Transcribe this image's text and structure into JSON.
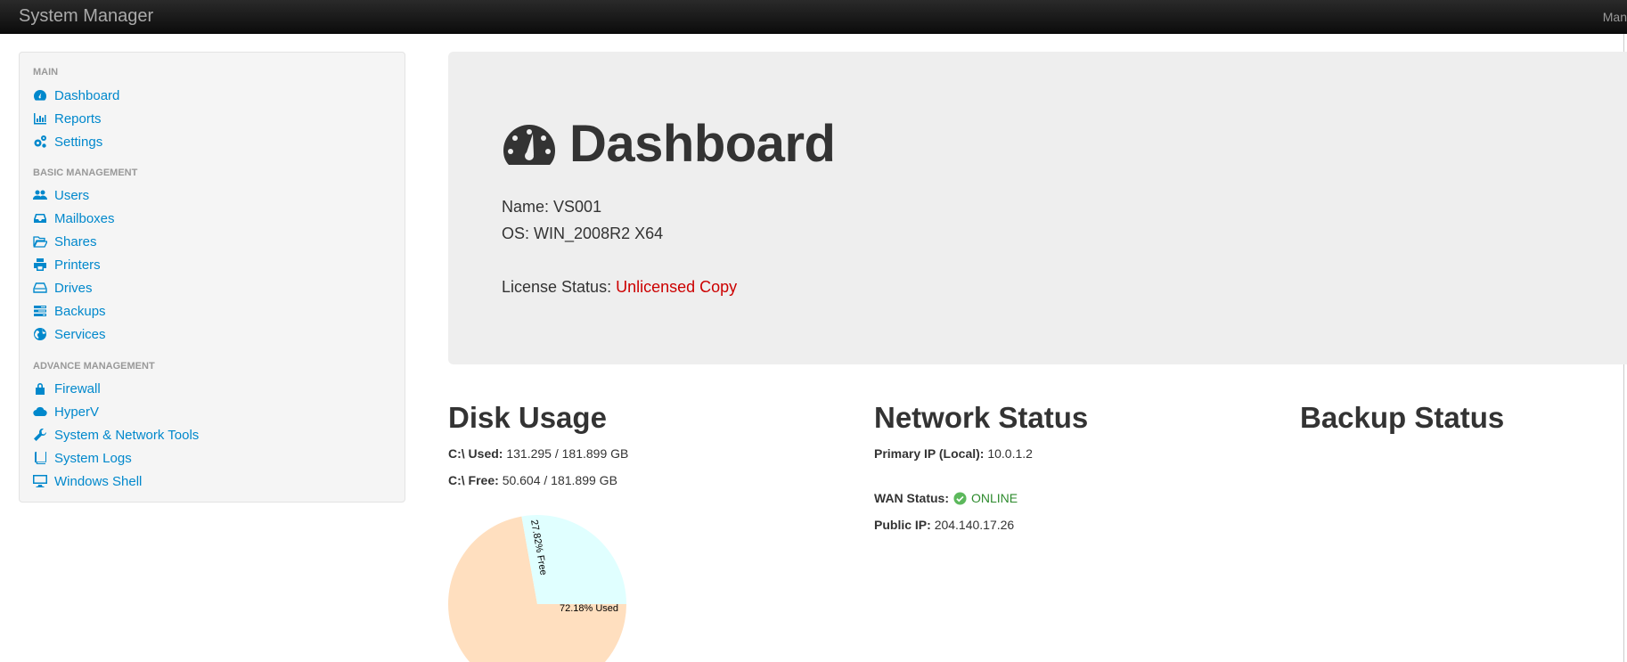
{
  "app": {
    "title": "System Manager",
    "nav_right": "Man"
  },
  "sidebar": {
    "sections": [
      {
        "header": "MAIN",
        "items": [
          {
            "label": "Dashboard",
            "icon": "dashboard-icon"
          },
          {
            "label": "Reports",
            "icon": "bar-chart-icon"
          },
          {
            "label": "Settings",
            "icon": "gears-icon"
          }
        ]
      },
      {
        "header": "BASIC MANAGEMENT",
        "items": [
          {
            "label": "Users",
            "icon": "users-icon"
          },
          {
            "label": "Mailboxes",
            "icon": "inbox-icon"
          },
          {
            "label": "Shares",
            "icon": "folder-open-icon"
          },
          {
            "label": "Printers",
            "icon": "print-icon"
          },
          {
            "label": "Drives",
            "icon": "hdd-icon"
          },
          {
            "label": "Backups",
            "icon": "tasks-icon"
          },
          {
            "label": "Services",
            "icon": "globe-icon"
          }
        ]
      },
      {
        "header": "ADVANCE MANAGEMENT",
        "items": [
          {
            "label": "Firewall",
            "icon": "lock-icon"
          },
          {
            "label": "HyperV",
            "icon": "cloud-icon"
          },
          {
            "label": "System & Network Tools",
            "icon": "wrench-icon"
          },
          {
            "label": "System Logs",
            "icon": "book-icon"
          },
          {
            "label": "Windows Shell",
            "icon": "desktop-icon"
          }
        ]
      }
    ]
  },
  "hero": {
    "title": "Dashboard",
    "name_label": "Name:",
    "name_value": "VS001",
    "os_label": "OS:",
    "os_value": "WIN_2008R2 X64",
    "license_label": "License Status:",
    "license_value": "Unlicensed Copy"
  },
  "disk": {
    "title": "Disk Usage",
    "used_label": "C:\\ Used:",
    "used_value": "131.295 / 181.899 GB",
    "free_label": "C:\\ Free:",
    "free_value": "50.604 / 181.899 GB"
  },
  "network": {
    "title": "Network Status",
    "primary_label": "Primary IP (Local):",
    "primary_value": "10.0.1.2",
    "wan_label": "WAN Status:",
    "wan_value": "ONLINE",
    "public_label": "Public IP:",
    "public_value": "204.140.17.26"
  },
  "backup": {
    "title": "Backup Status"
  },
  "colors": {
    "accent": "#0088cc",
    "license_red": "#cc0000",
    "online_green": "#2e8b2e",
    "pie_used": "#ffdfbf",
    "pie_free": "#e0ffff"
  },
  "chart_data": {
    "type": "pie",
    "slices": [
      {
        "label": "72.18% Used",
        "value": 72.18,
        "color": "#ffdfbf"
      },
      {
        "label": "27.82% Free",
        "value": 27.82,
        "color": "#e0ffff"
      }
    ]
  }
}
